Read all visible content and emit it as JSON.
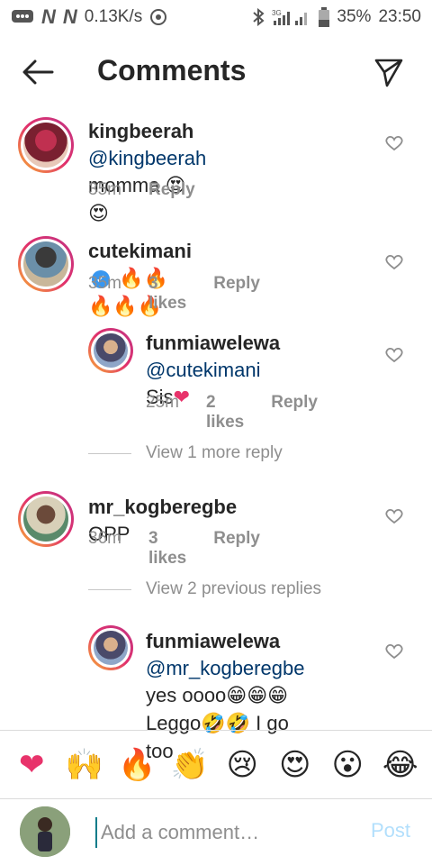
{
  "status_bar": {
    "speed": "0.13K/s",
    "network": "3G",
    "battery": "35%",
    "time": "23:50"
  },
  "header": {
    "title": "Comments",
    "back_icon": "arrow-left-icon",
    "send_icon": "paper-plane-icon"
  },
  "comments": [
    {
      "username": "kingbeerah",
      "mention": "@kingbeerah",
      "text": "momma",
      "emoji": "😍😍",
      "time": "35m",
      "likes": "",
      "reply": "Reply"
    },
    {
      "username": "cutekimani",
      "verified": true,
      "emoji": "🔥🔥🔥🔥🔥",
      "time": "35m",
      "likes": "3 likes",
      "reply": "Reply"
    },
    {
      "username": "funmiawelewa",
      "mention": "@cutekimani",
      "text": "Sis",
      "emoji": "❤",
      "time": "25m",
      "likes": "2 likes",
      "reply": "Reply"
    },
    {
      "username": "mr_kogberegbe",
      "text": "OPP",
      "time": "36m",
      "likes": "3 likes",
      "reply": "Reply"
    },
    {
      "username": "funmiawelewa",
      "mention": "@mr_kogberegbe",
      "line2_text": "yes oooo",
      "line2_emoji": "😁😁😁",
      "line3_text": "Leggo",
      "line3_emoji": "🤣🤣",
      "line3_tail": "I go too"
    }
  ],
  "view_more_1": "View 1 more reply",
  "view_more_2": "View 2 previous replies",
  "emoji_bar": [
    "❤",
    "🙌",
    "🔥",
    "👏",
    "😢",
    "😍",
    "😮",
    "😂"
  ],
  "composer": {
    "placeholder": "Add a comment…",
    "post_label": "Post"
  },
  "colors": {
    "text": "#262626",
    "muted": "#8e8e8e",
    "mention": "#00376b",
    "post_disabled": "#b2dffc",
    "ring_start": "#f9b233",
    "ring_end": "#c13584"
  }
}
